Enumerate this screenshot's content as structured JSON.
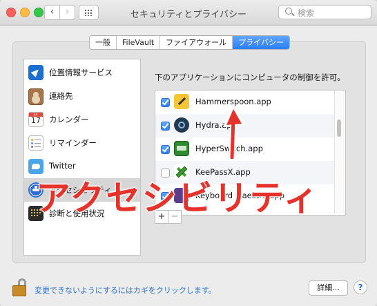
{
  "window": {
    "title": "セキュリティとプライバシー",
    "search_placeholder": "検索"
  },
  "tabs": [
    {
      "label": "一般",
      "active": false
    },
    {
      "label": "FileVault",
      "active": false
    },
    {
      "label": "ファイアウォール",
      "active": false
    },
    {
      "label": "プライバシー",
      "active": true
    }
  ],
  "sidebar": {
    "items": [
      {
        "label": "位置情報サービス",
        "icon": "location-icon",
        "selected": false
      },
      {
        "label": "連絡先",
        "icon": "contacts-icon",
        "selected": false
      },
      {
        "label": "カレンダー",
        "icon": "calendar-icon",
        "selected": false,
        "calendar_month": "JUL",
        "calendar_day": "17"
      },
      {
        "label": "リマインダー",
        "icon": "reminders-icon",
        "selected": false
      },
      {
        "label": "Twitter",
        "icon": "twitter-icon",
        "selected": false
      },
      {
        "label": "アクセシビリティ",
        "icon": "accessibility-icon",
        "selected": true
      },
      {
        "label": "診断と使用状況",
        "icon": "diagnostics-icon",
        "selected": false
      }
    ]
  },
  "main": {
    "heading": "下のアプリケーションにコンピュータの制御を許可。",
    "apps": [
      {
        "name": "Hammerspoon.app",
        "checked": true,
        "icon": "hammerspoon-icon"
      },
      {
        "name": "Hydra.app",
        "checked": true,
        "icon": "hydra-icon"
      },
      {
        "name": "HyperSwitch.app",
        "checked": true,
        "icon": "hyperswitch-icon"
      },
      {
        "name": "KeePassX.app",
        "checked": false,
        "icon": "keepassx-icon"
      },
      {
        "name": "Keyboard Maestro.app",
        "checked": true,
        "icon": "keyboard-maestro-icon"
      }
    ],
    "add_label": "+",
    "remove_label": "−"
  },
  "footer": {
    "lock_text": "変更できないようにするにはカギをクリックします。",
    "detail_button": "詳細...",
    "help_button": "?"
  },
  "overlay": {
    "caption": "アクセシビリティ",
    "color": "#e5322b"
  }
}
